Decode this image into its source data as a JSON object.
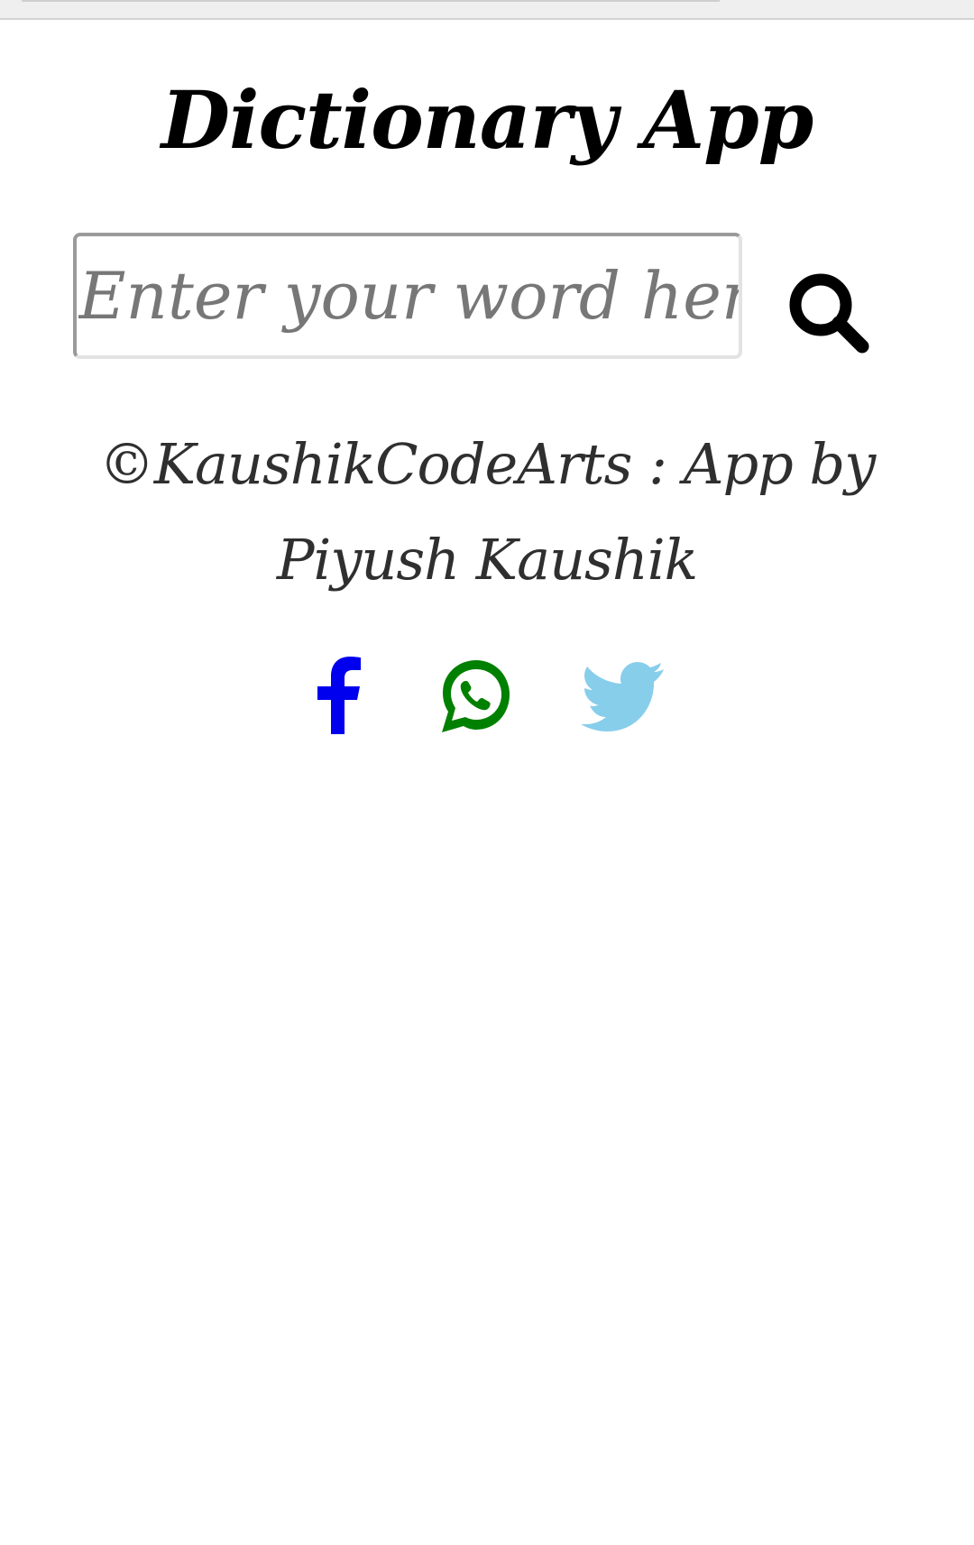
{
  "app": {
    "title": "Dictionary App"
  },
  "search": {
    "placeholder": "Enter your word here..",
    "value": "",
    "button_icon": "search-icon"
  },
  "footer": {
    "credit": "©KaushikCodeArts : App by Piyush Kaushik"
  },
  "social": [
    {
      "icon": "facebook-icon",
      "color": "#0000ee"
    },
    {
      "icon": "whatsapp-icon",
      "color": "#008000"
    },
    {
      "icon": "twitter-icon",
      "color": "#87ceeb"
    }
  ]
}
